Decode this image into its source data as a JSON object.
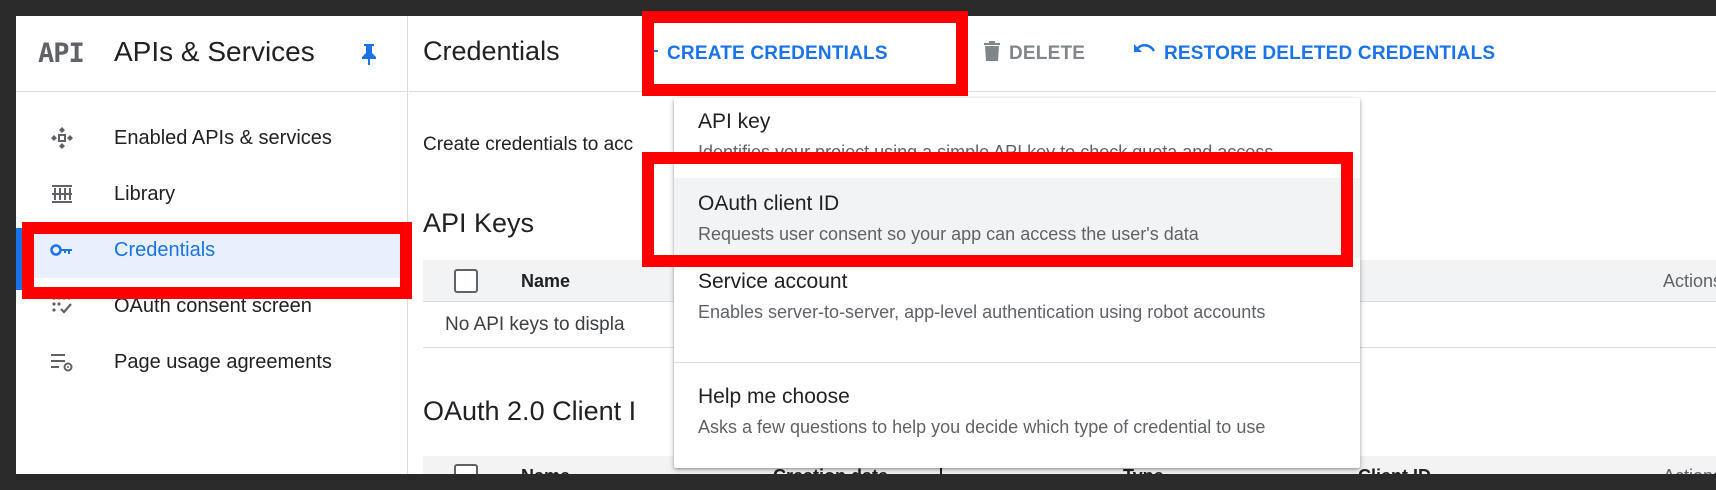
{
  "sidebar": {
    "logo_text": "API",
    "product_title": "APIs & Services",
    "items": [
      {
        "label": "Enabled APIs & services",
        "icon": "enabled-apis-icon"
      },
      {
        "label": "Library",
        "icon": "library-icon"
      },
      {
        "label": "Credentials",
        "icon": "key-icon",
        "active": true
      },
      {
        "label": "OAuth consent screen",
        "icon": "consent-icon"
      },
      {
        "label": "Page usage agreements",
        "icon": "settings-list-icon"
      }
    ]
  },
  "toolbar": {
    "title": "Credentials",
    "create_label": "CREATE CREDENTIALS",
    "delete_label": "DELETE",
    "restore_label": "RESTORE DELETED CREDENTIALS"
  },
  "content": {
    "intro": "Create credentials to acc",
    "api_keys_title": "API Keys",
    "api_keys_columns": [
      "Name",
      "Actions"
    ],
    "api_keys_empty": "No API keys to displa",
    "oauth_title": "OAuth 2.0 Client I",
    "oauth_columns": [
      "Name",
      "Creation date",
      "Type",
      "Client ID",
      "Actions"
    ]
  },
  "dropdown": {
    "items": [
      {
        "title": "API key",
        "desc": "Identifies your project using a simple API key to check quota and access"
      },
      {
        "title": "OAuth client ID",
        "desc": "Requests user consent so your app can access the user's data"
      },
      {
        "title": "Service account",
        "desc": "Enables server-to-server, app-level authentication using robot accounts"
      },
      {
        "title": "Help me choose",
        "desc": "Asks a few questions to help you decide which type of credential to use"
      }
    ]
  },
  "colors": {
    "accent": "#1a73e8",
    "annotation": "#ff0000",
    "active_bg": "#e8f0fe"
  }
}
